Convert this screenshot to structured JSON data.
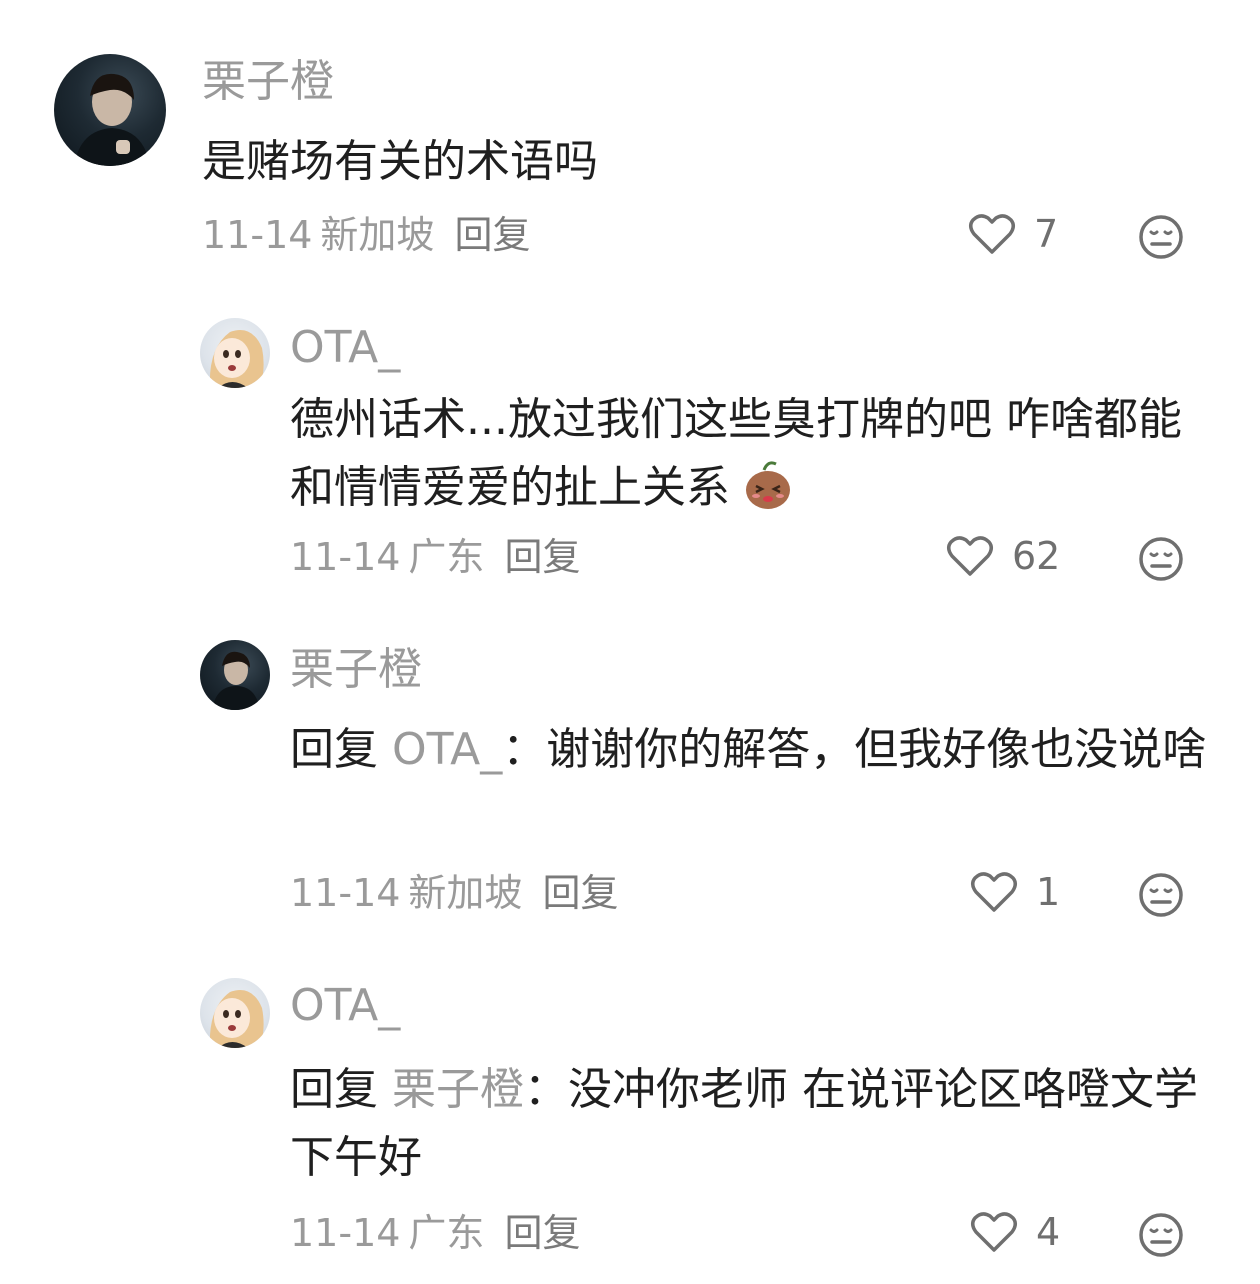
{
  "comments": [
    {
      "username": "栗子橙",
      "text": "是赌场有关的术语吗",
      "date": "11-14",
      "region": "新加坡",
      "reply_label": "回复",
      "likes": "7"
    },
    {
      "username": "OTA_",
      "text": "德州话术...放过我们这些臭打牌的吧 咋啥都能和情情爱爱的扯上关系",
      "date": "11-14",
      "region": "广东",
      "reply_label": "回复",
      "likes": "62"
    },
    {
      "username": "栗子橙",
      "reply_prefix": "回复",
      "reply_to": "OTA_",
      "text": "：谢谢你的解答，但我好像也没说啥",
      "date": "11-14",
      "region": "新加坡",
      "reply_label": "回复",
      "likes": "1"
    },
    {
      "username": "OTA_",
      "reply_prefix": "回复",
      "reply_to": "栗子橙",
      "text": "：没冲你老师 在说评论区咯噔文学 下午好",
      "date": "11-14",
      "region": "广东",
      "reply_label": "回复",
      "likes": "4"
    }
  ],
  "icons": {
    "like": "heart-outline-icon",
    "dislike": "meh-face-icon",
    "emoji": "embarrassed-potato-emoji"
  },
  "colors": {
    "username": "#9a9a9a",
    "text": "#1f1f1f",
    "meta": "#9a9a9a"
  }
}
